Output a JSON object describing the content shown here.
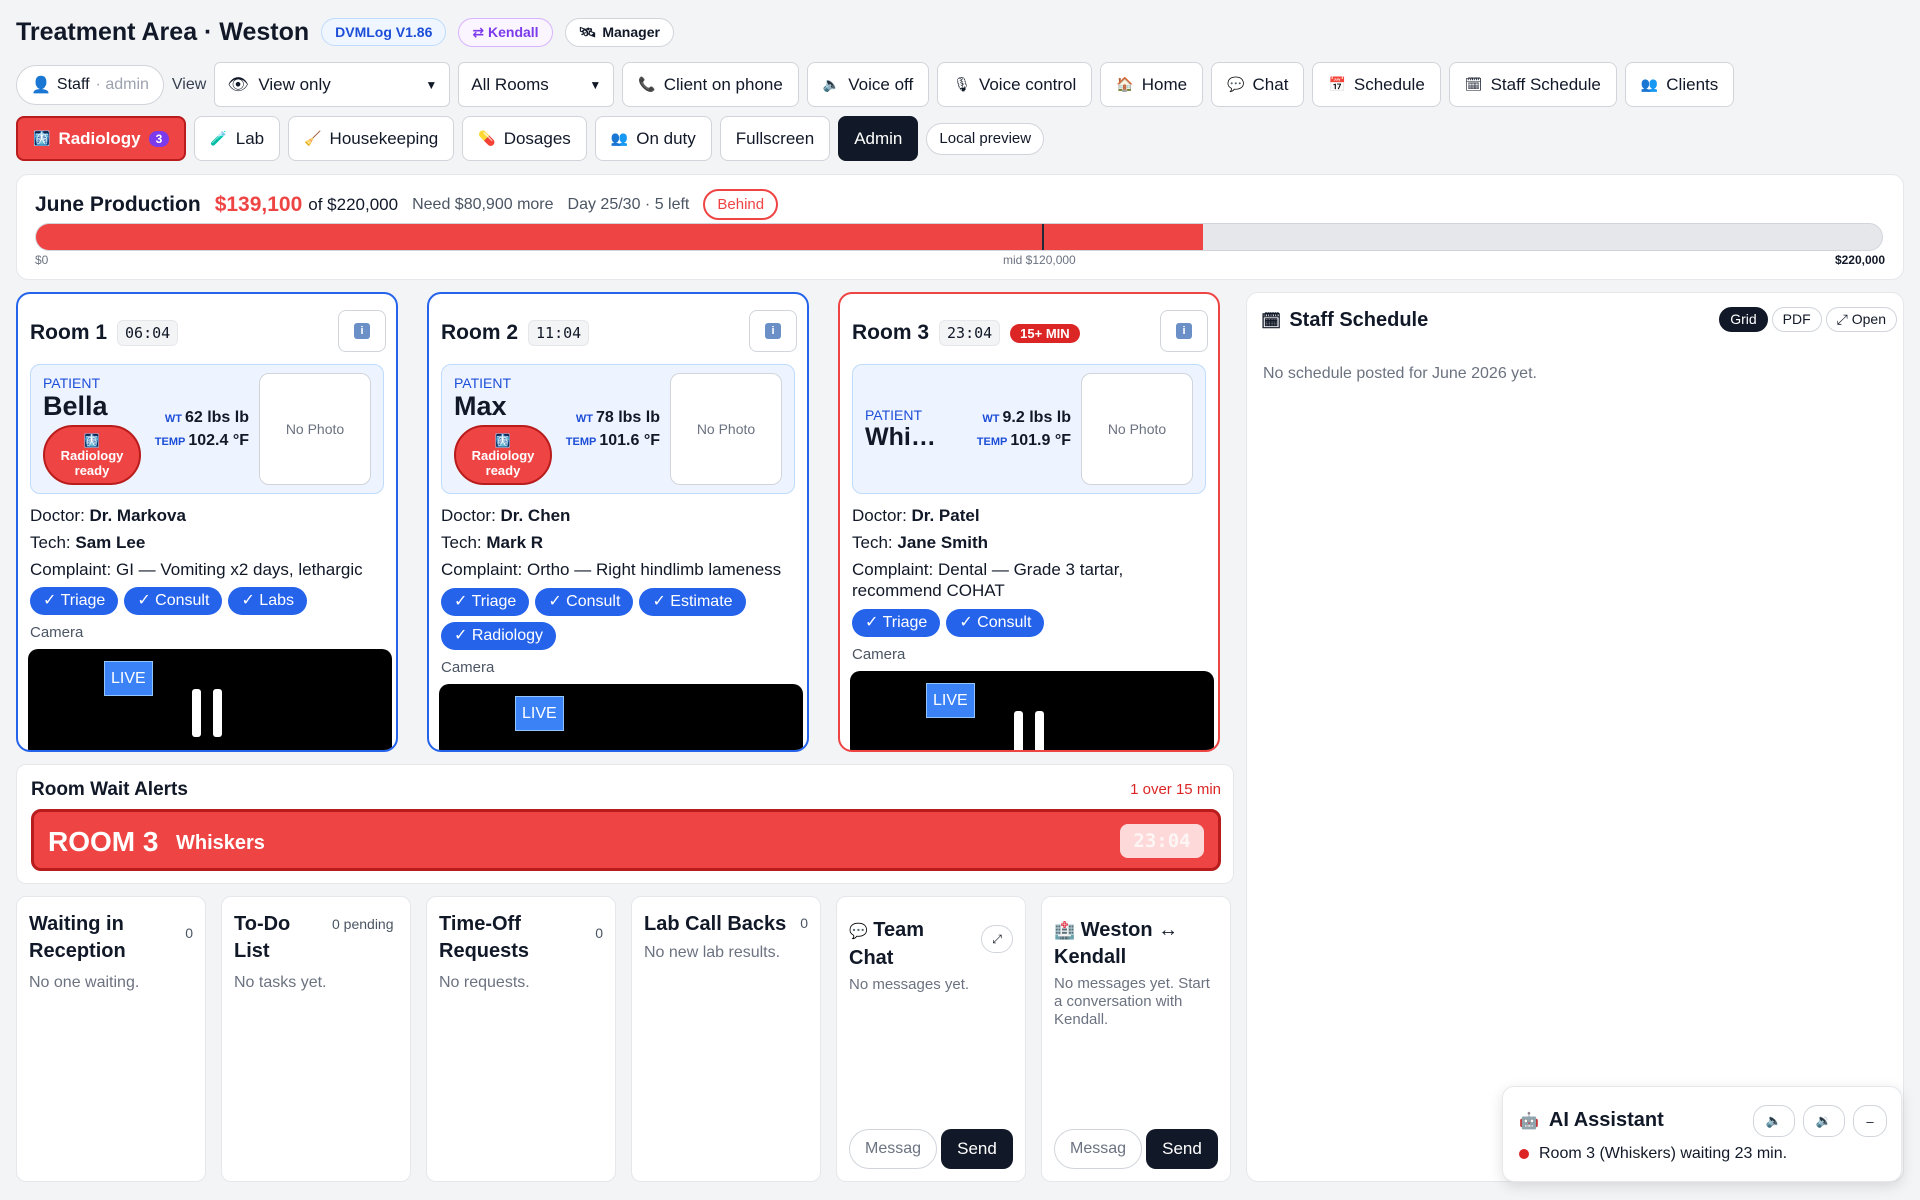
{
  "header": {
    "title": "Treatment Area · Weston",
    "version": "DVMLog V1.86",
    "location_switch": "⇄ Kendall",
    "role": "Manager"
  },
  "toolbar": {
    "staff_label": "Staff",
    "staff_role": "· admin",
    "view_label": "View",
    "view_select": "View only",
    "rooms_select": "All Rooms",
    "client_on_phone": "Client on phone",
    "voice_off": "Voice off",
    "voice_control": "Voice control",
    "home": "Home",
    "chat": "Chat",
    "schedule": "Schedule",
    "staff_schedule": "Staff Schedule",
    "clients": "Clients"
  },
  "toolbar2": {
    "radiology": "Radiology",
    "radiology_count": "3",
    "lab": "Lab",
    "housekeeping": "Housekeeping",
    "dosages": "Dosages",
    "on_duty": "On duty",
    "fullscreen": "Fullscreen",
    "admin": "Admin",
    "local_preview": "Local preview"
  },
  "production": {
    "title": "June Production",
    "amount": "$139,100",
    "of_goal": "of $220,000",
    "need": "Need $80,900 more",
    "day": "Day 25/30 · 5 left",
    "status": "Behind",
    "progress_fraction": 0.632,
    "mid_fraction": 0.545,
    "label_start": "$0",
    "label_mid": "mid $120,000",
    "label_end": "$220,000"
  },
  "rooms": [
    {
      "name": "Room 1",
      "timer": "06:04",
      "over_badge": "",
      "patient_label": "PATIENT",
      "patient": "Bella",
      "radiology_ready": "Radiology ready",
      "wt_label": "WT",
      "wt": "62 lbs lb",
      "temp_label": "TEMP",
      "temp": "102.4 °F",
      "photo": "No Photo",
      "doctor_label": "Doctor:",
      "doctor": "Dr. Markova",
      "tech_label": "Tech:",
      "tech": "Sam Lee",
      "complaint_label": "Complaint:",
      "complaint": "GI — Vomiting x2 days, lethargic",
      "chips": [
        "✓ Triage",
        "✓ Consult",
        "✓ Labs"
      ],
      "camera": "Camera",
      "live": "LIVE"
    },
    {
      "name": "Room 2",
      "timer": "11:04",
      "over_badge": "",
      "patient_label": "PATIENT",
      "patient": "Max",
      "radiology_ready": "Radiology ready",
      "wt_label": "WT",
      "wt": "78 lbs lb",
      "temp_label": "TEMP",
      "temp": "101.6 °F",
      "photo": "No Photo",
      "doctor_label": "Doctor:",
      "doctor": "Dr. Chen",
      "tech_label": "Tech:",
      "tech": "Mark R",
      "complaint_label": "Complaint:",
      "complaint": "Ortho — Right hindlimb lameness",
      "chips": [
        "✓ Triage",
        "✓ Consult",
        "✓ Estimate",
        "✓ Radiology"
      ],
      "camera": "Camera",
      "live": "LIVE"
    },
    {
      "name": "Room 3",
      "timer": "23:04",
      "over_badge": "15+ MIN",
      "patient_label": "PATIENT",
      "patient": "Whi…",
      "radiology_ready": "",
      "wt_label": "WT",
      "wt": "9.2 lbs lb",
      "temp_label": "TEMP",
      "temp": "101.9 °F",
      "photo": "No Photo",
      "doctor_label": "Doctor:",
      "doctor": "Dr. Patel",
      "tech_label": "Tech:",
      "tech": "Jane Smith",
      "complaint_label": "Complaint:",
      "complaint": "Dental — Grade 3 tartar, recommend COHAT",
      "chips": [
        "✓ Triage",
        "✓ Consult"
      ],
      "camera": "Camera",
      "live": "LIVE"
    }
  ],
  "alerts": {
    "title": "Room Wait Alerts",
    "count": "1 over 15 min",
    "room": "ROOM 3",
    "pet": "Whiskers",
    "timer": "23:04"
  },
  "panels": {
    "waiting": {
      "title": "Waiting in Reception",
      "count": "0",
      "body": "No one waiting."
    },
    "todo": {
      "title": "To-Do List",
      "count": "0 pending",
      "body": "No tasks yet."
    },
    "timeoff": {
      "title": "Time-Off Requests",
      "count": "0",
      "body": "No requests."
    },
    "lab": {
      "title": "Lab Call Backs",
      "count": "0",
      "body": "No new lab results."
    },
    "team_chat": {
      "title": "Team Chat",
      "body": "No messages yet.",
      "input": "Messag",
      "send": "Send"
    },
    "weston_kendall": {
      "title": "Weston ↔ Kendall",
      "body": "No messages yet. Start a conversation with Kendall.",
      "input": "Messag",
      "send": "Send"
    }
  },
  "schedule": {
    "title": "Staff Schedule",
    "tab_grid": "Grid",
    "tab_pdf": "PDF",
    "tab_open": "⤢ Open",
    "empty": "No schedule posted for June 2026 yet."
  },
  "assistant": {
    "title": "AI Assistant",
    "message": "Room 3 (Whiskers) waiting 23 min.",
    "minimize": "–"
  },
  "colors": {
    "accent_blue": "#2563eb",
    "alert_red": "#ef4444",
    "dark": "#111827"
  }
}
